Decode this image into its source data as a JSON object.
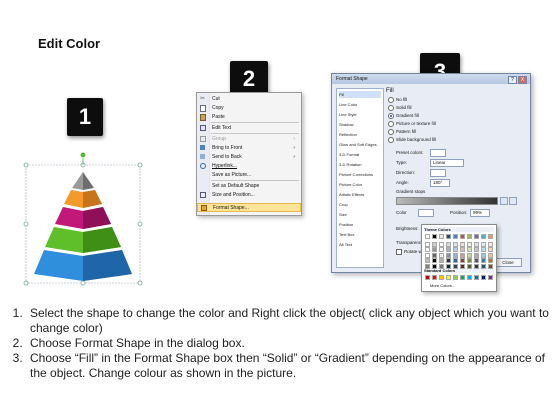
{
  "title": "Edit Color",
  "badges": [
    "1",
    "2",
    "3"
  ],
  "context_menu": {
    "items": [
      "Cut",
      "Copy",
      "Paste",
      "Edit Text",
      "Group",
      "Bring to Front",
      "Send to Back",
      "Hyperlink...",
      "Save as Picture...",
      "Set as Default Shape",
      "Size and Position...",
      "Format Shape..."
    ],
    "highlighted": "Format Shape..."
  },
  "dialog": {
    "title": "Format Shape",
    "title_buttons": [
      "?",
      "X"
    ],
    "nav": [
      "Fill",
      "Line Color",
      "Line Style",
      "Shadow",
      "Reflection",
      "Glow and Soft Edges",
      "3-D Format",
      "3-D Rotation",
      "Picture Corrections",
      "Picture Color",
      "Artistic Effects",
      "Crop",
      "Size",
      "Position",
      "Text Box",
      "Alt Text"
    ],
    "selected_nav": "Fill",
    "heading": "Fill",
    "options": [
      "No fill",
      "Solid fill",
      "Gradient fill",
      "Picture or texture fill",
      "Pattern fill",
      "Slide background fill"
    ],
    "selected_option": "Gradient fill",
    "preset_label": "Preset colors:",
    "type_label": "Type:",
    "type_value": "Linear",
    "direction_label": "Direction:",
    "angle_label": "Angle:",
    "angle_value": "180°",
    "stops_label": "Gradient stops",
    "color_label": "Color",
    "position_label": "Position:",
    "position_value": "99%",
    "brightness_label": "Brightness:",
    "transparency_label": "Transparency:",
    "rotate_label": "Rotate with shape",
    "close_button": "Close",
    "palette": {
      "theme_label": "Theme Colors",
      "standard_label": "Standard Colors",
      "more_label": "More Colors...",
      "theme_top": [
        "#ffffff",
        "#000000",
        "#eeece1",
        "#1f497d",
        "#4f81bd",
        "#c0504d",
        "#9bbb59",
        "#8064a2",
        "#4bacc6",
        "#f79646"
      ],
      "standard": [
        "#c00000",
        "#ff0000",
        "#ffc000",
        "#ffff00",
        "#92d050",
        "#00b050",
        "#00b0f0",
        "#0070c0",
        "#002060",
        "#7030a0"
      ]
    }
  },
  "pyramid": {
    "layers": [
      {
        "name": "top",
        "front": "#9a9a9a",
        "side": "#6e6e6e"
      },
      {
        "name": "orange",
        "front": "#f39a2a",
        "side": "#c7741a"
      },
      {
        "name": "magenta",
        "front": "#c2187a",
        "side": "#8f1058"
      },
      {
        "name": "green",
        "front": "#5fbf2a",
        "side": "#3f8f17"
      },
      {
        "name": "blue",
        "front": "#2f8fdc",
        "side": "#1f66a8"
      }
    ]
  },
  "instructions": [
    "Select the shape to change the color and Right click the object( click any object which you want to change color)",
    "Choose Format Shape in the dialog box.",
    "Choose “Fill” in the Format Shape box then “Solid” or “Gradient” depending on the appearance of the object. Change colour as shown in the picture."
  ]
}
